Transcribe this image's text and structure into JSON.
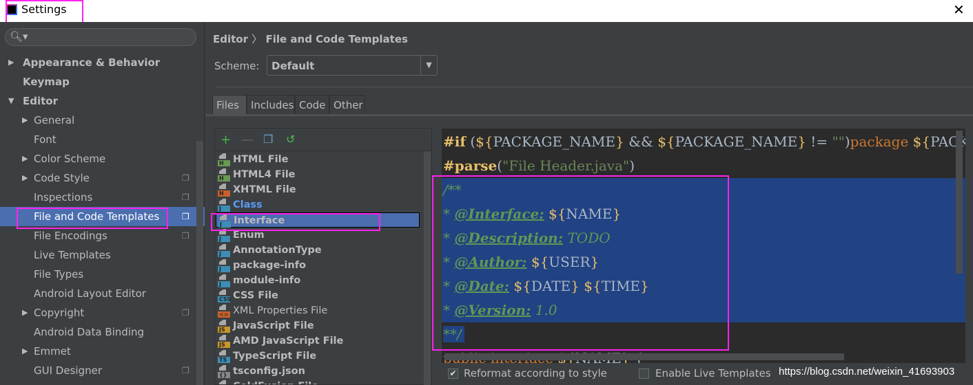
{
  "window": {
    "title": "Settings",
    "close_icon": "close-icon"
  },
  "sidebar": {
    "search_placeholder": "",
    "items": [
      {
        "label": "Appearance & Behavior",
        "level": 0,
        "arrow": "▶",
        "bold": true
      },
      {
        "label": "Keymap",
        "level": 0,
        "arrow": "",
        "bold": true
      },
      {
        "label": "Editor",
        "level": 0,
        "arrow": "▼",
        "bold": true
      },
      {
        "label": "General",
        "level": 1,
        "arrow": "▶"
      },
      {
        "label": "Font",
        "level": 1,
        "arrow": ""
      },
      {
        "label": "Color Scheme",
        "level": 1,
        "arrow": "▶"
      },
      {
        "label": "Code Style",
        "level": 1,
        "arrow": "▶",
        "copy": true
      },
      {
        "label": "Inspections",
        "level": 1,
        "arrow": "",
        "copy": true
      },
      {
        "label": "File and Code Templates",
        "level": 1,
        "arrow": "",
        "copy": true,
        "selected": true
      },
      {
        "label": "File Encodings",
        "level": 1,
        "arrow": "",
        "copy": true
      },
      {
        "label": "Live Templates",
        "level": 1,
        "arrow": ""
      },
      {
        "label": "File Types",
        "level": 1,
        "arrow": ""
      },
      {
        "label": "Android Layout Editor",
        "level": 1,
        "arrow": ""
      },
      {
        "label": "Copyright",
        "level": 1,
        "arrow": "▶",
        "copy": true
      },
      {
        "label": "Android Data Binding",
        "level": 1,
        "arrow": ""
      },
      {
        "label": "Emmet",
        "level": 1,
        "arrow": "▶"
      },
      {
        "label": "GUI Designer",
        "level": 1,
        "arrow": "",
        "copy": true
      }
    ]
  },
  "breadcrumb": {
    "parent": "Editor",
    "sep": "〉",
    "current": "File and Code Templates"
  },
  "scheme": {
    "label": "Scheme:",
    "value": "Default"
  },
  "tabs": [
    {
      "label": "Files",
      "selected": true
    },
    {
      "label": "Includes"
    },
    {
      "label": "Code"
    },
    {
      "label": "Other"
    }
  ],
  "templates": [
    {
      "label": "HTML File",
      "badge": "H",
      "color": "#6a9955"
    },
    {
      "label": "HTML4 File",
      "badge": "H",
      "color": "#6a9955"
    },
    {
      "label": "XHTML File",
      "badge": "H",
      "color": "#c8602e"
    },
    {
      "label": "Class",
      "badge": "J",
      "color": "#3d8db5",
      "link": true
    },
    {
      "label": "Interface",
      "badge": "J",
      "color": "#3d8db5",
      "selected": true
    },
    {
      "label": "Enum",
      "badge": "J",
      "color": "#3d8db5"
    },
    {
      "label": "AnnotationType",
      "badge": "J",
      "color": "#3d8db5"
    },
    {
      "label": "package-info",
      "badge": "J",
      "color": "#3d8db5"
    },
    {
      "label": "module-info",
      "badge": "J",
      "color": "#3d8db5"
    },
    {
      "label": "CSS File",
      "badge": "CSS",
      "color": "#3d8db5"
    },
    {
      "label": "XML Properties File",
      "badge": "<>",
      "color": "#c8602e",
      "normal": true
    },
    {
      "label": "JavaScript File",
      "badge": "JS",
      "color": "#c8952e"
    },
    {
      "label": "AMD JavaScript File",
      "badge": "JS",
      "color": "#c8952e"
    },
    {
      "label": "TypeScript File",
      "badge": "TS",
      "color": "#3d8db5"
    },
    {
      "label": "tsconfig.json",
      "badge": "{}",
      "color": "#888888"
    },
    {
      "label": "ColdFusion File",
      "badge": "CF",
      "color": "#dddddd"
    }
  ],
  "code": {
    "l1": {
      "a": "#if",
      "b": " (",
      "c": "${",
      "d": "PACKAGE_NAME",
      "e": "}",
      "f": " && ",
      "g": "${",
      "h": "PACKAGE_NAME",
      "i": "}",
      "j": " != ",
      "k": "\"\"",
      "l": ")",
      "m": "package",
      "n": " ${",
      "o": "PACKAGE_NAME"
    },
    "l2": {
      "a": "#parse",
      "b": "(",
      "c": "\"File Header.java\"",
      "d": ")"
    },
    "l3": "/**",
    "l4": {
      "star": "* ",
      "tag": "@Interface:",
      "v1": " ${",
      "v2": "NAME",
      "v3": "}"
    },
    "l5": {
      "star": "* ",
      "tag": "@Description:",
      "rest": " TODO"
    },
    "l6": {
      "star": "* ",
      "tag": "@Author:",
      "v1": " ${",
      "v2": "USER",
      "v3": "}"
    },
    "l7": {
      "star": "* ",
      "tag": "@Date:",
      "v1": " ${",
      "v2": "DATE",
      "v3": "}",
      "v4": " ${",
      "v5": "TIME",
      "v6": "}"
    },
    "l8": {
      "star": "* ",
      "tag": "@Version:",
      "rest": " 1.0"
    },
    "l9": "**/",
    "l10": {
      "a": "public interface",
      "b": " ${",
      "c": "NAME",
      "d": "}",
      "e": " {"
    }
  },
  "options": {
    "reformat": {
      "label": "Reformat according to style",
      "checked": true
    },
    "live": {
      "label": "Enable Live Templates",
      "checked": false
    }
  },
  "watermark": "https://blog.csdn.net/weixin_41693903",
  "colors": {
    "accent": "#4b6eaf",
    "selection": "#214283",
    "highlight_box": "#ff22ee"
  }
}
